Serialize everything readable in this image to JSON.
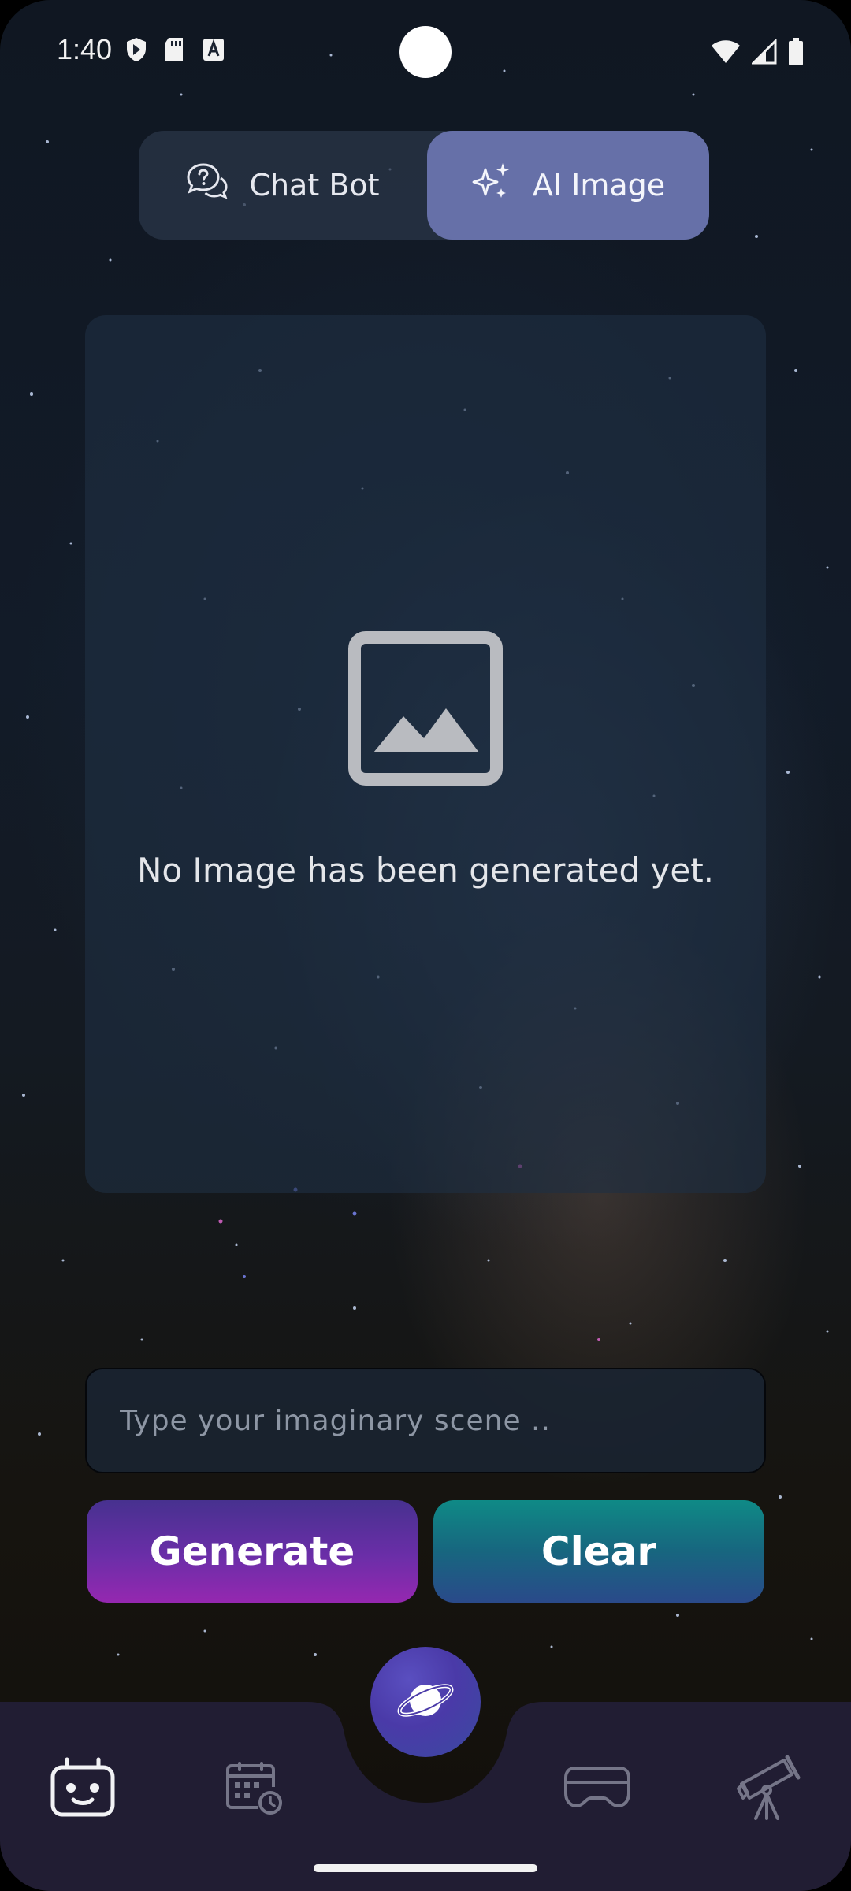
{
  "status_bar": {
    "time": "1:40",
    "icons_left": [
      "shield-icon",
      "sd-card-icon",
      "font-a-icon"
    ],
    "icons_right": [
      "wifi-icon",
      "signal-icon",
      "battery-icon"
    ]
  },
  "tabs": [
    {
      "label": "Chat Bot",
      "icon": "chat-question-icon",
      "selected": false
    },
    {
      "label": "AI Image",
      "icon": "sparkles-icon",
      "selected": true
    }
  ],
  "preview": {
    "icon": "image-placeholder-icon",
    "message": "No Image has been generated yet."
  },
  "prompt": {
    "placeholder": "Type your imaginary scene ..",
    "value": ""
  },
  "actions": {
    "generate_label": "Generate",
    "clear_label": "Clear"
  },
  "bottom_nav": {
    "items": [
      {
        "icon": "robot-icon",
        "active": true
      },
      {
        "icon": "calendar-clock-icon",
        "active": false
      },
      {
        "icon": "planet-icon",
        "active": false
      },
      {
        "icon": "vr-headset-icon",
        "active": false
      },
      {
        "icon": "telescope-icon",
        "active": false
      }
    ]
  },
  "colors": {
    "tab_selected": "#6670a8",
    "generate_gradient": [
      "#47318f",
      "#9528b0"
    ],
    "clear_gradient": [
      "#0f8a86",
      "#2a4a8a"
    ],
    "nav_background": "#211d33",
    "nav_active_icon": "#f2f2f5",
    "nav_inactive_icon": "#757588"
  }
}
